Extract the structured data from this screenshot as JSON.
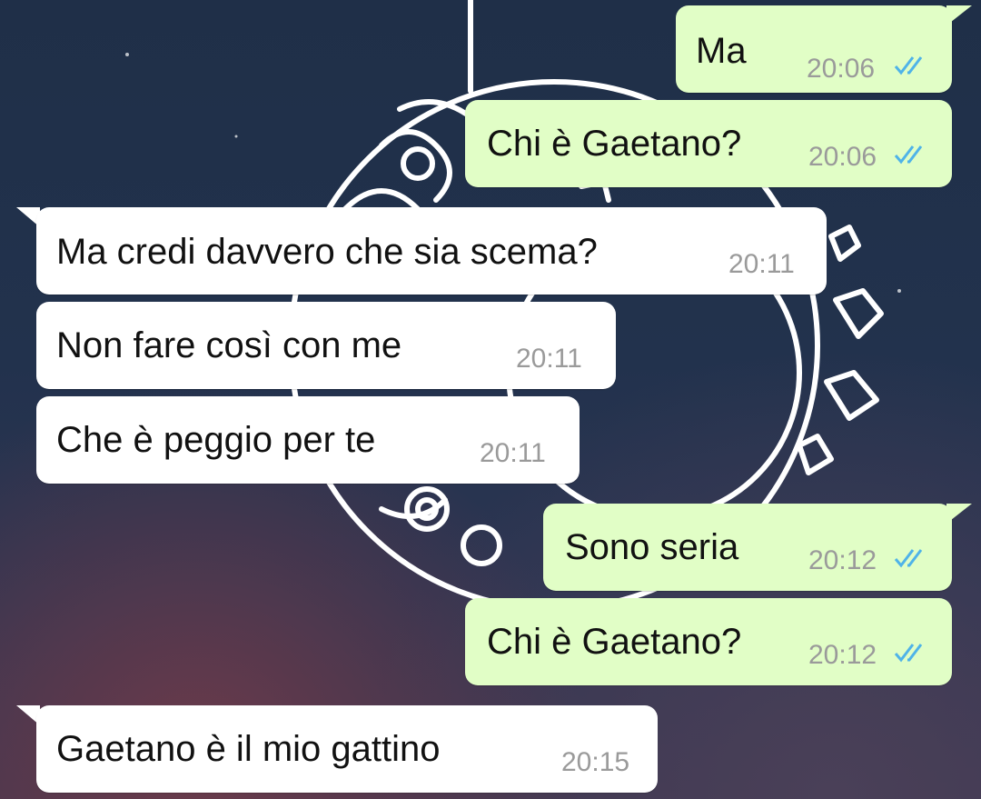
{
  "messages": [
    {
      "direction": "outgoing",
      "text": "Ma",
      "time": "20:06",
      "status": "read"
    },
    {
      "direction": "outgoing",
      "text": "Chi è Gaetano?",
      "time": "20:06",
      "status": "read"
    },
    {
      "direction": "incoming",
      "text": "Ma credi davvero che sia scema?",
      "time": "20:11"
    },
    {
      "direction": "incoming",
      "text": "Non fare così con me",
      "time": "20:11"
    },
    {
      "direction": "incoming",
      "text": "Che è peggio per te",
      "time": "20:11"
    },
    {
      "direction": "outgoing",
      "text": "Sono seria",
      "time": "20:12",
      "status": "read"
    },
    {
      "direction": "outgoing",
      "text": "Chi è Gaetano?",
      "time": "20:12",
      "status": "read"
    },
    {
      "direction": "incoming",
      "text": "Gaetano è il mio gattino",
      "time": "20:15"
    }
  ],
  "colors": {
    "outgoing_bubble": "#e1fec6",
    "incoming_bubble": "#ffffff",
    "read_ticks": "#4fb3e8",
    "timestamp": "#9a9a9a"
  },
  "icons": {
    "read_receipt": "double-check-icon",
    "wallpaper": "moon-dreamcatcher-illustration"
  }
}
